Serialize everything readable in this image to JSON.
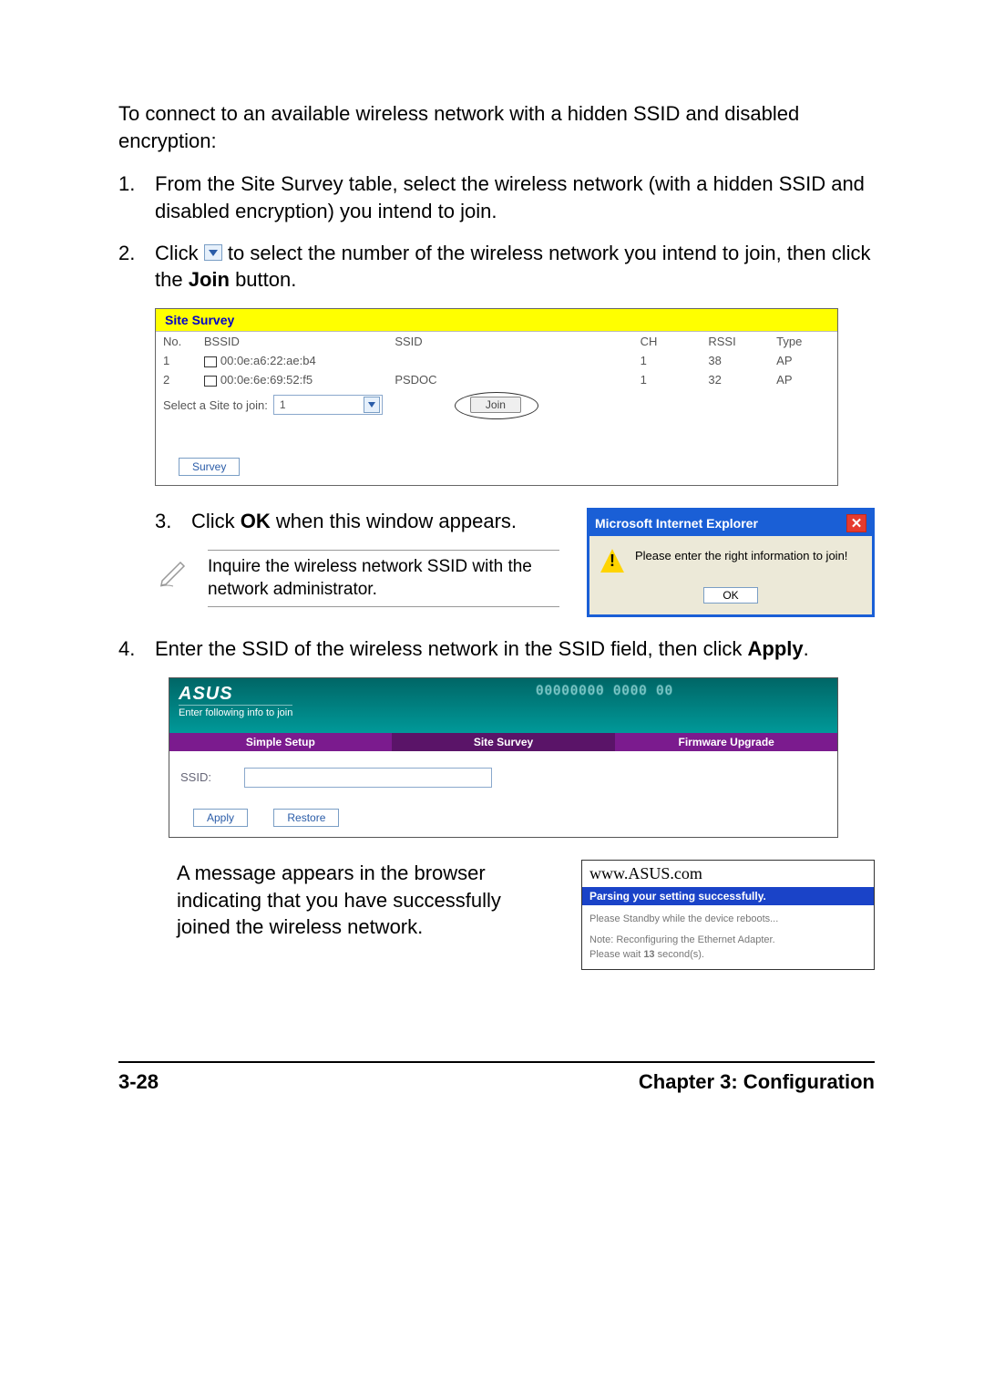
{
  "intro": "To connect to an available wireless network with a hidden SSID and disabled encryption:",
  "step1": "From the Site Survey table, select the wireless network (with a hidden SSID and disabled encryption) you intend to join.",
  "step2_a": "Click ",
  "step2_b": " to select the number of the wireless network you intend to join, then click the ",
  "step2_bold": "Join",
  "step2_c": " button.",
  "siteSurvey": {
    "title": "Site Survey",
    "headers": {
      "no": "No.",
      "bssid": "BSSID",
      "ssid": "SSID",
      "ch": "CH",
      "rssi": "RSSI",
      "type": "Type"
    },
    "rows": [
      {
        "no": "1",
        "bssid": "00:0e:a6:22:ae:b4",
        "ssid": "",
        "ch": "1",
        "rssi": "38",
        "type": "AP"
      },
      {
        "no": "2",
        "bssid": "00:0e:6e:69:52:f5",
        "ssid": "PSDOC",
        "ch": "1",
        "rssi": "32",
        "type": "AP"
      }
    ],
    "selectLabel": "Select a Site to join:",
    "selectValue": "1",
    "joinBtn": "Join",
    "surveyBtn": "Survey"
  },
  "step3_a": "Click ",
  "step3_bold": "OK",
  "step3_b": " when this window appears.",
  "note": "Inquire the wireless network SSID with the network administrator.",
  "ieDialog": {
    "title": "Microsoft Internet Explorer",
    "msg": "Please enter the right information to join!",
    "ok": "OK"
  },
  "step4_a": "Enter the SSID of the wireless network in the SSID field, then click ",
  "step4_bold": "Apply",
  "step4_b": ".",
  "asus": {
    "logo": "ASUS",
    "sub": "Enter following info to join",
    "mac": "00000000 0000 00",
    "tabs": {
      "setup": "Simple Setup",
      "survey": "Site Survey",
      "fw": "Firmware Upgrade"
    },
    "ssidLabel": "SSID:",
    "applyBtn": "Apply",
    "restoreBtn": "Restore"
  },
  "successText": "A message appears in the browser indicating that you have successfully joined the wireless network.",
  "successBox": {
    "url": "www.ASUS.com",
    "bar": "Parsing your setting successfully.",
    "line1": "Please Standby while the device reboots...",
    "line2": "Note: Reconfiguring the Ethernet Adapter.",
    "line3": "Please wait 13 second(s)."
  },
  "footer": {
    "page": "3-28",
    "chapter": "Chapter 3: Configuration"
  }
}
